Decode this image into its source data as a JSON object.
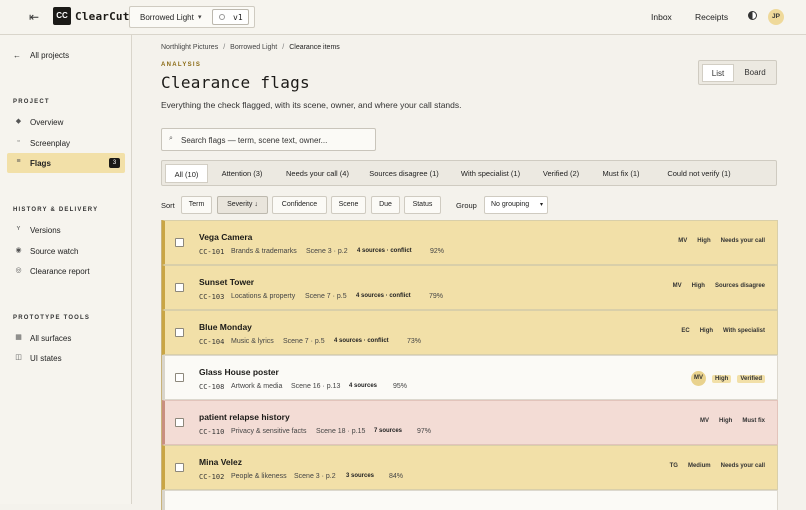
{
  "app": {
    "name": "ClearCut",
    "logo": "CC"
  },
  "topbar": {
    "project": "Borrowed Light",
    "version": "v1",
    "inbox": "Inbox",
    "receipts": "Receipts",
    "avatar": "JP"
  },
  "sidebar": {
    "all_projects": "All projects",
    "project_heading": "PROJECT",
    "project_items": [
      {
        "label": "Overview",
        "icon": "overview-icon"
      },
      {
        "label": "Screenplay",
        "icon": "screenplay-icon"
      },
      {
        "label": "Flags",
        "icon": "list-icon",
        "count": "3"
      }
    ],
    "history_heading": "HISTORY & DELIVERY",
    "history_items": [
      {
        "label": "Versions",
        "icon": "branch-icon"
      },
      {
        "label": "Source watch",
        "icon": "radar-icon"
      },
      {
        "label": "Clearance report",
        "icon": "report-icon"
      }
    ],
    "tools_heading": "PROTOTYPE TOOLS",
    "tools_items": [
      {
        "label": "All surfaces",
        "icon": "grid-icon"
      },
      {
        "label": "UI states",
        "icon": "states-icon"
      }
    ]
  },
  "breadcrumb": [
    "Northlight Pictures",
    "Borrowed Light",
    "Clearance items"
  ],
  "eyebrow": "ANALYSIS",
  "title": "Clearance flags",
  "subtitle": "Everything the check flagged, with its scene, owner, and where your call stands.",
  "view_toggle": [
    "List",
    "Board"
  ],
  "search": {
    "placeholder": "Search flags — term, scene text, owner..."
  },
  "filters": [
    "All (10)",
    "Attention (3)",
    "Needs your call (4)",
    "Sources disagree (1)",
    "With specialist (1)",
    "Verified (2)",
    "Must fix (1)",
    "Could not verify (1)"
  ],
  "sort": {
    "label": "Sort",
    "options": [
      "Term",
      "Severity ↓",
      "Confidence",
      "Scene",
      "Due",
      "Status"
    ],
    "active": "Severity ↓"
  },
  "group": {
    "label": "Group",
    "value": "No grouping"
  },
  "rows": [
    {
      "title": "Vega Camera",
      "id": "CC-101",
      "category": "Brands & trademarks",
      "scene": "Scene 3 · p.2",
      "sources": "4 sources · conflict",
      "confidence": "92%",
      "owner": "MV",
      "severity": "High",
      "status": "Needs your call"
    },
    {
      "title": "Sunset Tower",
      "id": "CC-103",
      "category": "Locations & property",
      "scene": "Scene 7 · p.5",
      "sources": "4 sources · conflict",
      "confidence": "79%",
      "owner": "MV",
      "severity": "High",
      "status": "Sources disagree"
    },
    {
      "title": "Blue Monday",
      "id": "CC-104",
      "category": "Music & lyrics",
      "scene": "Scene 7 · p.5",
      "sources": "4 sources · conflict",
      "confidence": "73%",
      "owner": "EC",
      "severity": "High",
      "status": "With specialist"
    },
    {
      "title": "Glass House poster",
      "id": "CC-108",
      "category": "Artwork & media",
      "scene": "Scene 16 · p.13",
      "sources": "4 sources",
      "confidence": "95%",
      "owner": "MV",
      "severity": "High",
      "status": "Verified"
    },
    {
      "title": "patient relapse history",
      "id": "CC-110",
      "category": "Privacy & sensitive facts",
      "scene": "Scene 18 · p.15",
      "sources": "7 sources",
      "confidence": "97%",
      "owner": "MV",
      "severity": "High",
      "status": "Must fix"
    },
    {
      "title": "Mina Velez",
      "id": "CC-102",
      "category": "People & likeness",
      "scene": "Scene 3 · p.2",
      "sources": "3 sources",
      "confidence": "84%",
      "owner": "TG",
      "severity": "Medium",
      "status": "Needs your call"
    }
  ]
}
